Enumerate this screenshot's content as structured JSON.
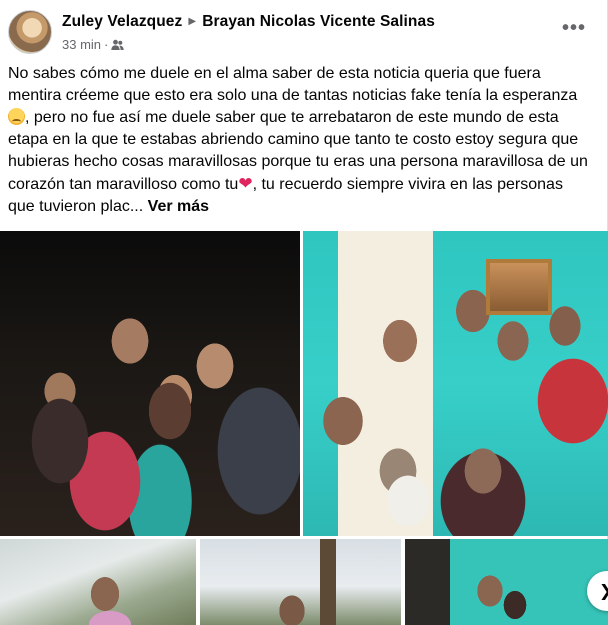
{
  "post": {
    "author": "Zuley Velazquez",
    "recipient": "Brayan Nicolas Vicente Salinas",
    "timestamp": "33 min",
    "separator": "·",
    "audience_icon": "friends-icon",
    "more_icon": "more-options-icon",
    "more_label": "•••",
    "text_parts": {
      "p1": "No sabes cómo me duele en el alma saber de esta noticia queria que fuera mentira créeme que esto era solo una de tantas noticias fake tenía la esperanza",
      "p2": ", pero no fue así me duele saber que te arrebataron de este mundo de esta etapa en la que te estabas abriendo camino que tanto te costo estoy segura que hubieras hecho cosas maravillosas porque tu eras una persona maravillosa de un corazón tan maravilloso como tu",
      "p3": ", tu recuerdo siempre vivira en las personas que tuvieron plac...",
      "see_more": "Ver más"
    },
    "emojis": [
      "disappointed-face-emoji",
      "red-heart-emoji"
    ],
    "heart_glyph": "❤"
  },
  "photos": {
    "count": 5,
    "items": [
      "group-night-photo",
      "family-indoor-photo",
      "palm-tree-photo",
      "outdoor-tree-photo",
      "indoor-teal-photo"
    ]
  },
  "colors": {
    "text_primary": "#050505",
    "text_secondary": "#65676b",
    "heart": "#e0245e"
  }
}
